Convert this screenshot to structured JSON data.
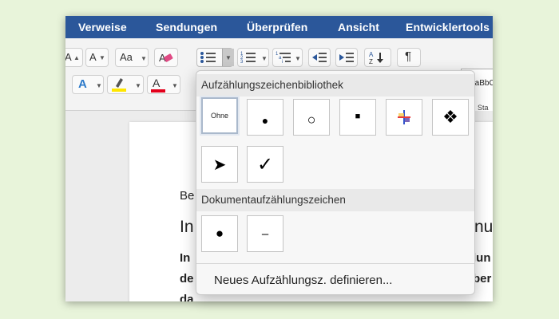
{
  "ribbon": {
    "tabs": [
      "Verweise",
      "Sendungen",
      "Überprüfen",
      "Ansicht",
      "Entwicklertools"
    ]
  },
  "toolbar": {
    "increase_font": "A",
    "decrease_font": "A",
    "change_case": "Aa",
    "text_effects": "A",
    "font_color": "A",
    "style_preview": "AaBbC",
    "style_label": "Sta"
  },
  "document": {
    "line1": "Be",
    "heading": "In",
    "heading_right": "nu",
    "para_left": [
      "In",
      "de",
      "da"
    ],
    "para_right": [
      "lun",
      "ber",
      ""
    ]
  },
  "bullet_menu": {
    "library_title": "Aufzählungszeichenbibliothek",
    "library": [
      {
        "label": "Ohne",
        "selected": true
      },
      {
        "symbol": "●"
      },
      {
        "symbol": "○"
      },
      {
        "symbol": "■"
      },
      {
        "symbol": "+",
        "icon": "color-plus-icon"
      },
      {
        "symbol": "❖"
      },
      {
        "symbol": "➤"
      },
      {
        "symbol": "✓"
      }
    ],
    "document_title": "Dokumentaufzählungszeichen",
    "document_bullets": [
      {
        "symbol": "●"
      },
      {
        "symbol": "–"
      }
    ],
    "define_label": "Neues Aufzählungsz. definieren..."
  },
  "colors": {
    "ribbon": "#2b579a",
    "highlight": "#ffe600",
    "font_color": "#e3001b"
  }
}
